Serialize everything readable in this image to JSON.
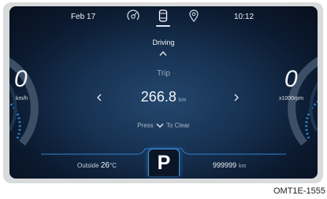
{
  "status_bar": {
    "date": "Feb 17",
    "time": "10:12",
    "icons": [
      "gauge-icon",
      "car-icon",
      "location-pin-icon"
    ],
    "active_icon": "car-icon"
  },
  "info_panel": {
    "mode": "Driving",
    "item_label": "Trip",
    "value": "266.8",
    "unit": "km",
    "hint_before": "Press",
    "hint_after": "To Clear"
  },
  "speedometer": {
    "value": "0",
    "unit": "km/h"
  },
  "tachometer": {
    "value": "0",
    "unit": "x1000rpm"
  },
  "bottom_bar": {
    "outside_label": "Outside",
    "outside_temp": "26",
    "outside_unit": "°C",
    "gear": "P",
    "odometer": "999999",
    "odometer_unit": "km"
  },
  "figure_code": "OMT1E-1555",
  "colors": {
    "screen_bg": "#0c1b31",
    "accent_blue": "#3f8fd6",
    "frame": "#d9dadb"
  }
}
